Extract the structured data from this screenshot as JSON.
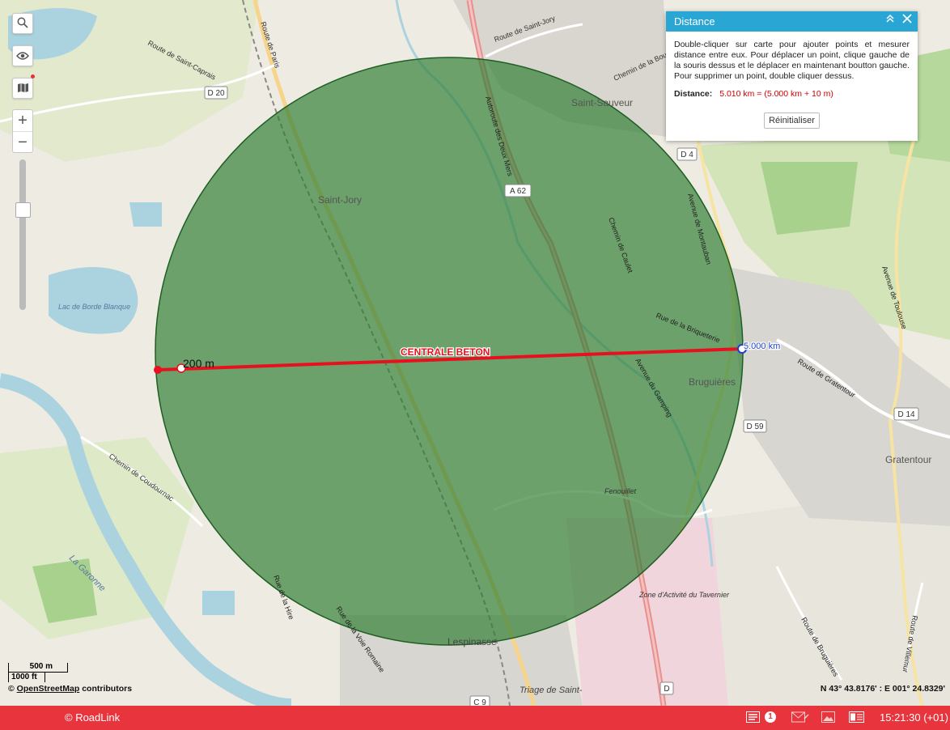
{
  "map": {
    "place_labels": [
      {
        "text": "Saint-Jory"
      },
      {
        "text": "Saint-Sauveur"
      },
      {
        "text": "Bruguières"
      },
      {
        "text": "Gratentour"
      },
      {
        "text": "Fenouillet"
      },
      {
        "text": "Lespinasse"
      },
      {
        "text": "Lac de Borde Blanque"
      },
      {
        "text": "Zone d'Activité du Tavernier"
      },
      {
        "text": "Triage de Saint-"
      },
      {
        "text": "La Garonne"
      }
    ],
    "road_labels": [
      {
        "text": "Route de Saint-Caprais"
      },
      {
        "text": "Route de Paris"
      },
      {
        "text": "Route de Saint-Jory"
      },
      {
        "text": "Chemin de la Bouffarde"
      },
      {
        "text": "Autoroute des Deux Mers"
      },
      {
        "text": "Chemin de Coudournac"
      },
      {
        "text": "Rue de la Briqueterie"
      },
      {
        "text": "Route de Gratentour"
      },
      {
        "text": "Avenue de Toulouse"
      },
      {
        "text": "Avenue de Montauban"
      },
      {
        "text": "Rue de la Hire"
      },
      {
        "text": "Rue de la Voie Romaine"
      },
      {
        "text": "Route de Bruguières"
      },
      {
        "text": "Route de Villemur"
      },
      {
        "text": "Chemin de Caulet"
      },
      {
        "text": "Avenue du Gamping"
      }
    ],
    "road_badges": [
      "D 20",
      "D 4",
      "A 62",
      "D 59",
      "D 14",
      "C 9",
      "D"
    ],
    "measure": {
      "label_center": "CENTRALE BETON",
      "label_start": "200 m",
      "label_end": "5.000 km",
      "line_color": "#e8101e",
      "circle_fill": "#2e7d32",
      "circle_stroke": "#1f5e24"
    }
  },
  "controls": {
    "search_icon": "search-icon",
    "eye_icon": "eye-icon",
    "layers_icon": "map-layers-icon",
    "zoom_in": "+",
    "zoom_out": "−",
    "zoom_level_fraction": 0.32
  },
  "panel": {
    "title": "Distance",
    "instructions": "Double-cliquer sur carte pour ajouter points et mesurer distance entre eux. Pour déplacer un point, clique gauche de la souris dessus et le déplacer en maintenant boutton gauche. Pour supprimer un point, double cliquer dessus.",
    "distance_label": "Distance:",
    "distance_value": "5.010 km = (5.000 km + 10 m)",
    "reset_label": "Réinitialiser"
  },
  "scale": {
    "metric": "500 m",
    "imperial": "1000 ft"
  },
  "attribution": {
    "prefix": "©",
    "link": "OpenStreetMap",
    "suffix": "contributors"
  },
  "coordinates": "N 43° 43.8176' : E 001° 24.8329'",
  "statusbar": {
    "brand": "© RoadLink",
    "notification_count": "1",
    "time": "15:21:30 (+01)"
  }
}
